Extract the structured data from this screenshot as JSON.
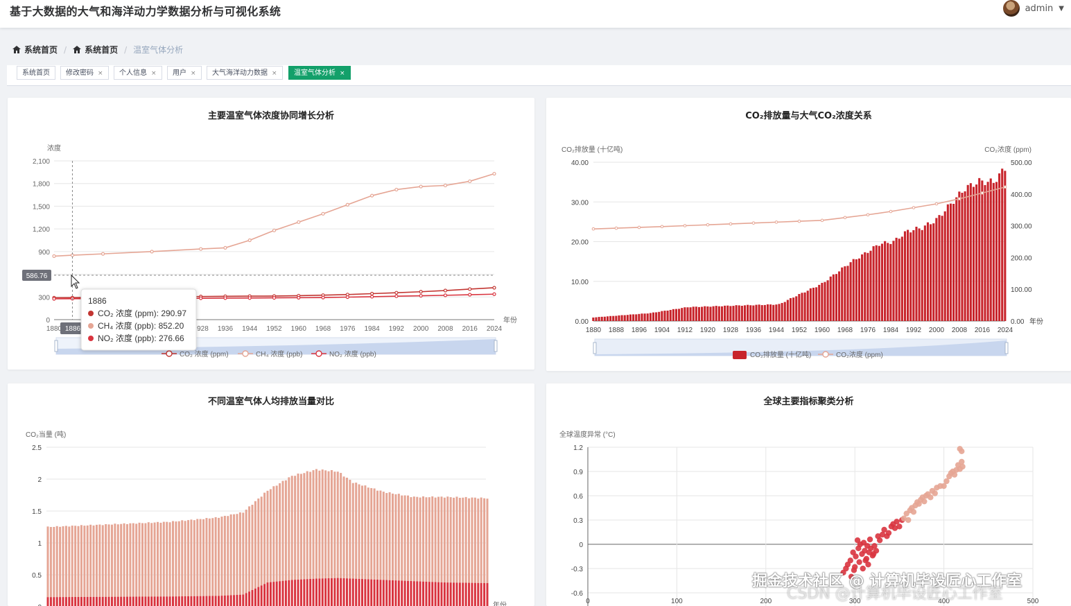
{
  "app": {
    "title": "基于大数据的大气和海洋动力学数据分析与可视化系统",
    "user": "admin"
  },
  "breadcrumb": {
    "items": [
      "系统首页",
      "系统首页"
    ],
    "current": "温室气体分析"
  },
  "tabs": [
    {
      "label": "系统首页",
      "closable": false,
      "active": false
    },
    {
      "label": "修改密码",
      "closable": true,
      "active": false
    },
    {
      "label": "个人信息",
      "closable": true,
      "active": false
    },
    {
      "label": "用户",
      "closable": true,
      "active": false
    },
    {
      "label": "大气海洋动力数据",
      "closable": true,
      "active": false
    },
    {
      "label": "温室气体分析",
      "closable": true,
      "active": true
    }
  ],
  "colors": {
    "accent": "#13a06a",
    "co2": "#c23531",
    "ch4": "#e5a594",
    "no2": "#d9343f",
    "bar": "#c8242b"
  },
  "chart_data": [
    {
      "type": "line",
      "title": "主要温室气体浓度协同增长分析",
      "ylabel": "浓度",
      "xlabel": "年份",
      "ylim": [
        0,
        2100
      ],
      "yticks": [
        "0",
        "300",
        "600",
        "900",
        "1,200",
        "1,500",
        "1,800",
        "2,100"
      ],
      "xticks": [
        "1880",
        "1888",
        "1896",
        "1904",
        "1912",
        "1920",
        "1928",
        "1936",
        "1944",
        "1952",
        "1960",
        "1968",
        "1976",
        "1984",
        "1992",
        "2000",
        "2008",
        "2016",
        "2024"
      ],
      "x": [
        1880,
        1886,
        1896,
        1912,
        1928,
        1936,
        1944,
        1952,
        1960,
        1968,
        1976,
        1984,
        1992,
        2000,
        2008,
        2016,
        2024
      ],
      "series": [
        {
          "name": "CO₂ 浓度 (ppm)",
          "values": [
            290,
            291,
            294,
            300,
            306,
            309,
            311,
            312,
            317,
            324,
            332,
            344,
            356,
            369,
            385,
            404,
            422
          ]
        },
        {
          "name": "CH₄ 浓度 (ppb)",
          "values": [
            840,
            852,
            870,
            900,
            935,
            950,
            1050,
            1180,
            1290,
            1400,
            1520,
            1640,
            1720,
            1760,
            1775,
            1830,
            1930
          ]
        },
        {
          "name": "NO₂ 浓度 (ppb)",
          "values": [
            275,
            277,
            278,
            280,
            283,
            285,
            286,
            288,
            290,
            292,
            298,
            303,
            310,
            316,
            322,
            330,
            337
          ]
        }
      ],
      "legend_position": "bottom",
      "axis_pointer": {
        "x_label": "1886",
        "y_label": "586.76"
      },
      "tooltip": {
        "title": "1886",
        "rows": [
          "CO₂ 浓度 (ppm): 290.97",
          "CH₄ 浓度 (ppb): 852.20",
          "NO₂ 浓度 (ppb): 276.66"
        ]
      }
    },
    {
      "type": "bar",
      "title": "CO₂排放量与大气CO₂浓度关系",
      "ylabel": "CO₂排放量 (十亿吨)",
      "ylabel_right": "CO₂浓度 (ppm)",
      "xlabel": "年份",
      "ylim": [
        0,
        40
      ],
      "ylim_right": [
        0,
        500
      ],
      "yticks": [
        "0.00",
        "10.00",
        "20.00",
        "30.00",
        "40.00"
      ],
      "yticks_right": [
        "0.00",
        "100.00",
        "200.00",
        "300.00",
        "400.00",
        "500.00"
      ],
      "xticks": [
        "1880",
        "1888",
        "1896",
        "1904",
        "1912",
        "1920",
        "1928",
        "1936",
        "1944",
        "1952",
        "1960",
        "1968",
        "1976",
        "1984",
        "1992",
        "2000",
        "2008",
        "2016",
        "2024"
      ],
      "bar_anchor_years": [
        1880,
        1900,
        1913,
        1930,
        1945,
        1950,
        1960,
        1970,
        1975,
        1980,
        1985,
        1990,
        1995,
        2000,
        2005,
        2010,
        2015,
        2020,
        2024
      ],
      "bar_anchor_values": [
        0.9,
        2.0,
        3.5,
        3.9,
        4.2,
        6.0,
        9.4,
        14.8,
        17.0,
        19.4,
        20.0,
        22.7,
        23.5,
        25.5,
        29.5,
        33.4,
        35.2,
        35.0,
        38.5
      ],
      "line_anchor_years": [
        1880,
        1900,
        1920,
        1940,
        1960,
        1980,
        2000,
        2010,
        2024
      ],
      "line_anchor_values": [
        290,
        296,
        303,
        310,
        317,
        339,
        369,
        389,
        422
      ],
      "series": [
        {
          "name": "CO₂排放量 (十亿吨)"
        },
        {
          "name": "CO₂浓度 (ppm)"
        }
      ],
      "legend_position": "bottom"
    },
    {
      "type": "bar",
      "title": "不同温室气体人均排放当量对比",
      "ylabel": "CO₂当量 (吨)",
      "xlabel": "年份",
      "ylim": [
        0,
        2.5
      ],
      "yticks": [
        "0",
        "0.5",
        "1",
        "1.5",
        "2",
        "2.5"
      ],
      "stack_anchor_years": [
        1880,
        1920,
        1936,
        1944,
        1952,
        1960,
        1968,
        1975,
        1980,
        1990,
        2000,
        2010,
        2024
      ],
      "bottom_anchor_values": [
        0.15,
        0.16,
        0.17,
        0.19,
        0.38,
        0.42,
        0.44,
        0.45,
        0.44,
        0.42,
        0.4,
        0.38,
        0.37
      ],
      "total_anchor_values": [
        1.25,
        1.33,
        1.4,
        1.48,
        1.82,
        2.05,
        2.15,
        2.12,
        1.95,
        1.8,
        1.72,
        1.72,
        1.7
      ]
    },
    {
      "type": "scatter",
      "title": "全球主要指标聚类分析",
      "ylabel": "全球温度异常 (°C)",
      "xlim": [
        0,
        500
      ],
      "ylim": [
        -0.6,
        1.2
      ],
      "xticks": [
        "0",
        "100",
        "200",
        "300",
        "400",
        "500"
      ],
      "yticks": [
        "-0.6",
        "-0.3",
        "0",
        "0.3",
        "0.6",
        "0.9",
        "1.2"
      ],
      "clusters": [
        {
          "points": [
            [
              287,
              -0.35
            ],
            [
              290,
              -0.3
            ],
            [
              292,
              -0.25
            ],
            [
              295,
              -0.2
            ],
            [
              296,
              -0.4
            ],
            [
              298,
              -0.1
            ],
            [
              300,
              -0.28
            ],
            [
              301,
              -0.15
            ],
            [
              303,
              0.05
            ],
            [
              304,
              -0.05
            ],
            [
              305,
              -0.22
            ],
            [
              306,
              0.0
            ],
            [
              308,
              -0.12
            ],
            [
              309,
              -0.3
            ],
            [
              310,
              0.02
            ],
            [
              311,
              -0.08
            ],
            [
              313,
              -0.18
            ],
            [
              314,
              -0.02
            ],
            [
              316,
              -0.1
            ],
            [
              318,
              -0.05
            ],
            [
              320,
              -0.14
            ],
            [
              322,
              -0.02
            ],
            [
              324,
              -0.08
            ],
            [
              315,
              -0.25
            ],
            [
              299,
              -0.32
            ],
            [
              312,
              -0.2
            ],
            [
              317,
              0.06
            ],
            [
              321,
              -0.12
            ],
            [
              326,
              0.1
            ],
            [
              328,
              0.05
            ],
            [
              331,
              0.12
            ],
            [
              333,
              0.18
            ],
            [
              336,
              0.1
            ],
            [
              338,
              0.14
            ],
            [
              341,
              0.22
            ],
            [
              343,
              0.25
            ],
            [
              345,
              0.2
            ],
            [
              347,
              0.28
            ],
            [
              350,
              0.22
            ],
            [
              353,
              0.3
            ]
          ]
        },
        {
          "points": [
            [
              355,
              0.32
            ],
            [
              358,
              0.38
            ],
            [
              360,
              0.3
            ],
            [
              362,
              0.42
            ],
            [
              364,
              0.45
            ],
            [
              366,
              0.4
            ],
            [
              368,
              0.48
            ],
            [
              370,
              0.52
            ],
            [
              372,
              0.5
            ],
            [
              374,
              0.55
            ],
            [
              376,
              0.58
            ],
            [
              378,
              0.53
            ],
            [
              380,
              0.6
            ],
            [
              382,
              0.62
            ],
            [
              385,
              0.58
            ],
            [
              387,
              0.66
            ],
            [
              390,
              0.63
            ],
            [
              392,
              0.7
            ],
            [
              396,
              0.72
            ],
            [
              400,
              0.72
            ],
            [
              403,
              0.78
            ],
            [
              406,
              0.84
            ],
            [
              408,
              0.88
            ],
            [
              410,
              0.9
            ],
            [
              412,
              0.86
            ],
            [
              414,
              0.92
            ],
            [
              416,
              0.98
            ],
            [
              418,
              0.93
            ],
            [
              420,
              1.02
            ],
            [
              421,
              0.96
            ],
            [
              418,
              1.18
            ],
            [
              420,
              1.15
            ]
          ]
        }
      ]
    }
  ],
  "watermark": {
    "line1": "掘金技术社区 @ 计算机毕设匠心工作室",
    "line2": "CSDN @计算机毕设匠心工作室"
  }
}
